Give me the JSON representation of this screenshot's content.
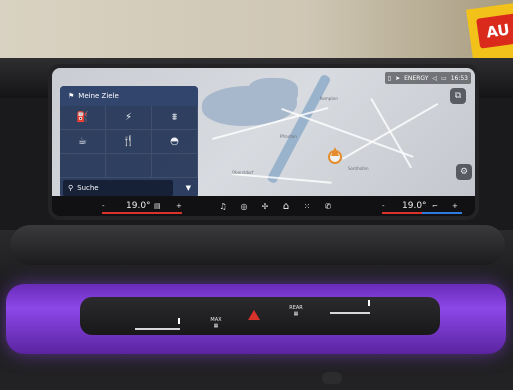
{
  "status_bar": {
    "energy_label": "ENERGY",
    "time": "16:53"
  },
  "panel": {
    "title": "Meine Ziele",
    "categories": [
      {
        "icon": "fuel-pump-icon"
      },
      {
        "icon": "charging-station-icon"
      },
      {
        "icon": "picnic-table-icon"
      },
      {
        "icon": "coffee-cup-icon"
      },
      {
        "icon": "restaurant-icon"
      },
      {
        "icon": "burger-icon"
      }
    ],
    "search_placeholder": "Suche"
  },
  "map": {
    "places": [
      "Oberstdorf",
      "Pfronten",
      "Sonthofen",
      "Kempten"
    ]
  },
  "climate": {
    "left_temp": "19.0°",
    "right_temp": "19.0°",
    "minus": "-",
    "plus": "+"
  },
  "console": {
    "max_label": "MAX",
    "rear_label": "REAR"
  },
  "colors": {
    "panel_bg": "#223456",
    "accent_orange": "#e58d2e",
    "ambient_purple": "#8c47e8",
    "hazard_red": "#d8322a",
    "temp_left": "#d8322a",
    "temp_right": "#2f7be0"
  }
}
